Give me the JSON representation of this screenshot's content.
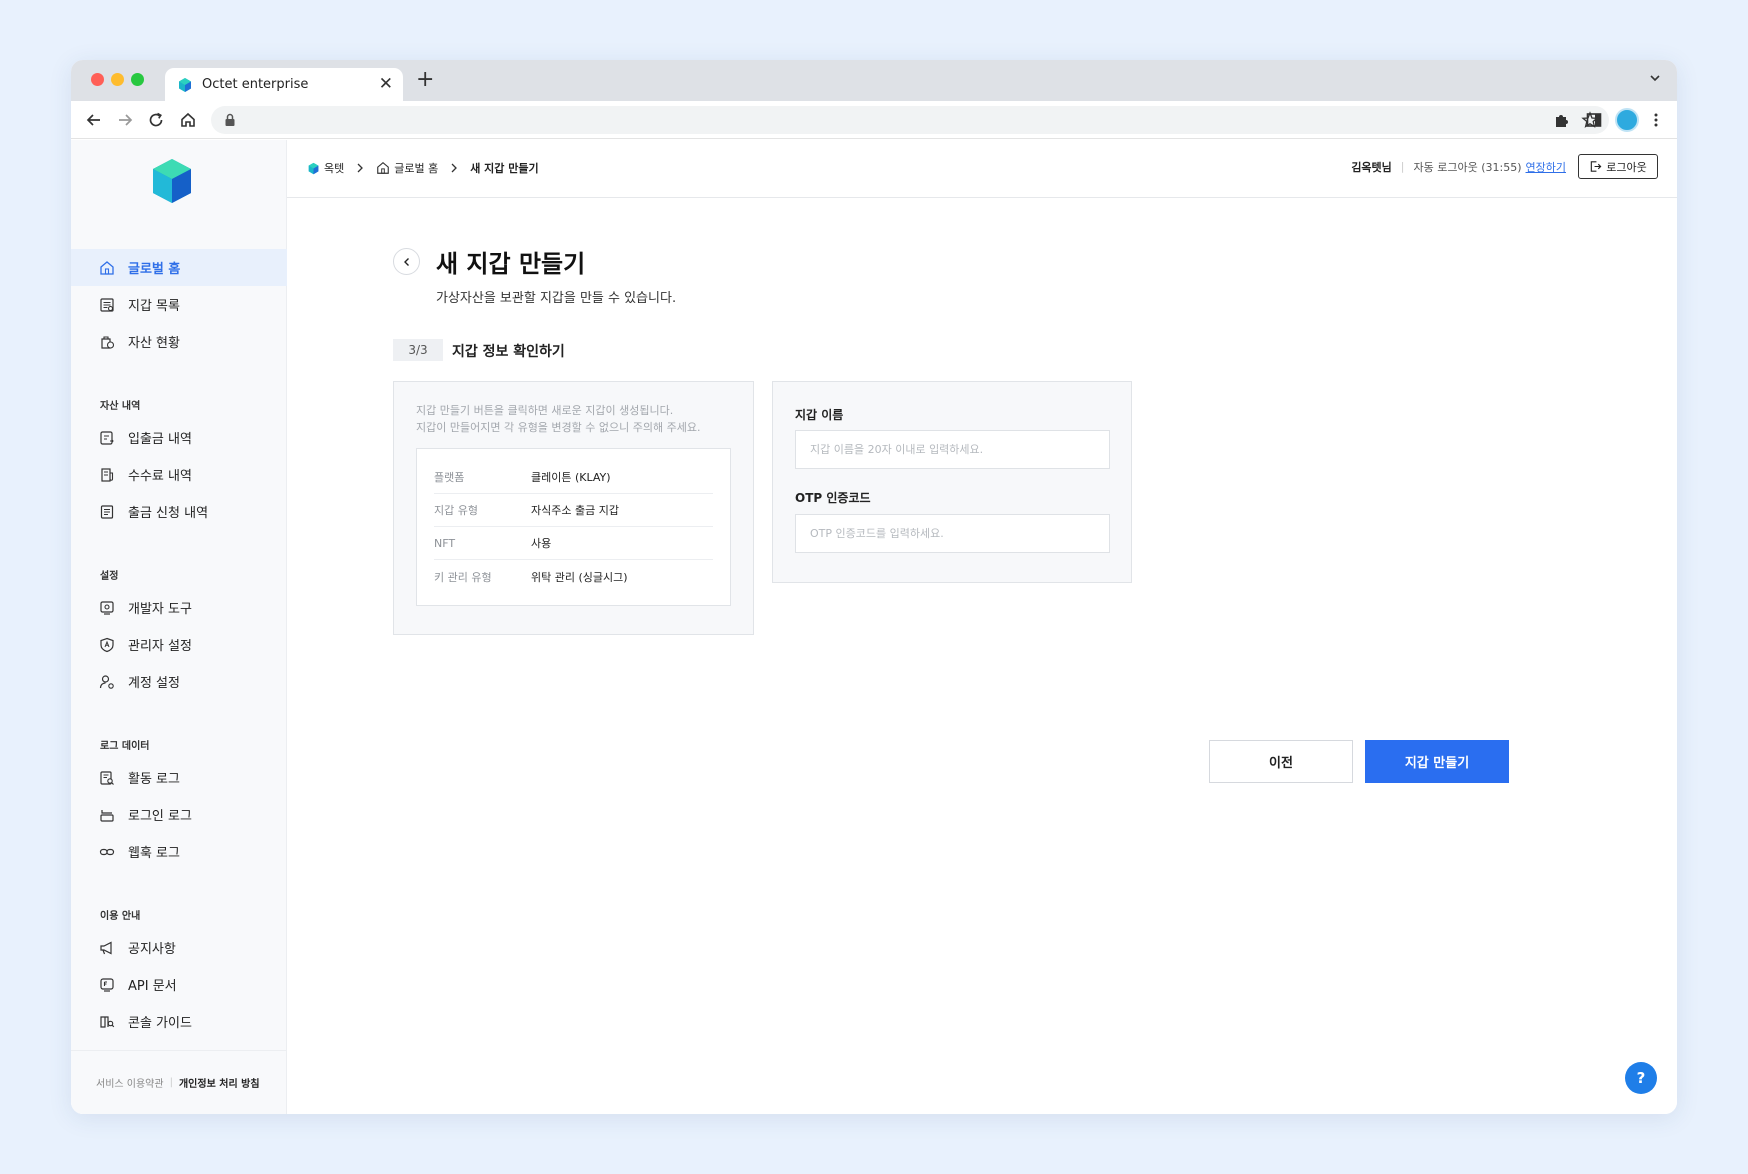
{
  "browser": {
    "tab_title": "Octet enterprise",
    "tab_close": "✕",
    "new_tab": "+"
  },
  "sidebar": {
    "top_items": [
      {
        "label": "글로벌 홈",
        "icon": "home-icon",
        "active": true
      },
      {
        "label": "지갑 목록",
        "icon": "wallet-list-icon"
      },
      {
        "label": "자산 현황",
        "icon": "asset-status-icon"
      }
    ],
    "sections": [
      {
        "title": "자산 내역",
        "items": [
          {
            "label": "입출금 내역",
            "icon": "transaction-icon"
          },
          {
            "label": "수수료 내역",
            "icon": "fee-icon"
          },
          {
            "label": "출금 신청 내역",
            "icon": "withdraw-request-icon"
          }
        ]
      },
      {
        "title": "설정",
        "items": [
          {
            "label": "개발자 도구",
            "icon": "developer-tools-icon"
          },
          {
            "label": "관리자 설정",
            "icon": "admin-shield-icon"
          },
          {
            "label": "계정 설정",
            "icon": "account-settings-icon"
          }
        ]
      },
      {
        "title": "로그 데이터",
        "items": [
          {
            "label": "활동 로그",
            "icon": "activity-log-icon"
          },
          {
            "label": "로그인 로그",
            "icon": "login-log-icon"
          },
          {
            "label": "웹훅 로그",
            "icon": "webhook-link-icon"
          }
        ]
      },
      {
        "title": "이용 안내",
        "items": [
          {
            "label": "공지사항",
            "icon": "megaphone-icon"
          },
          {
            "label": "API 문서",
            "icon": "api-doc-icon"
          },
          {
            "label": "콘솔 가이드",
            "icon": "console-guide-icon"
          }
        ]
      }
    ],
    "footer": {
      "terms": "서비스 이용약관",
      "separator": "|",
      "privacy": "개인정보 처리 방침"
    }
  },
  "header": {
    "breadcrumb": [
      "옥텟",
      "글로벌 홈",
      "새 지갑 만들기"
    ],
    "user_name": "김옥텟님",
    "separator": "|",
    "auto_logout": "자동 로그아웃 (31:55)",
    "extend_label": "연장하기",
    "logout_label": "로그아웃"
  },
  "page": {
    "title": "새 지갑 만들기",
    "subtitle": "가상자산을 보관할 지갑을 만들 수 있습니다.",
    "step": "3/3",
    "step_title": "지갑 정보 확인하기",
    "notice_lines": [
      "지갑 만들기 버튼을 클릭하면 새로운 지갑이 생성됩니다.",
      "지갑이 만들어지면 각 유형을 변경할 수 없으니 주의해 주세요."
    ],
    "info_rows": [
      {
        "key": "플랫폼",
        "value": "클레이튼 (KLAY)"
      },
      {
        "key": "지갑 유형",
        "value": "자식주소 출금 지갑"
      },
      {
        "key": "NFT",
        "value": "사용"
      },
      {
        "key": "키 관리 유형",
        "value": "위탁 관리 (싱글시그)"
      }
    ],
    "wallet_name_label": "지갑 이름",
    "wallet_name_value": "",
    "wallet_name_placeholder": "지갑 이름을 20자 이내로 입력하세요.",
    "otp_label": "OTP 인증코드",
    "otp_value": "",
    "otp_placeholder": "OTP 인증코드를 입력하세요.",
    "prev_button": "이전",
    "create_button": "지갑 만들기",
    "help_label": "?"
  },
  "colors": {
    "accent": "#2a6ef0",
    "active_nav_bg": "#e8f0fc",
    "page_bg": "#e8f1fd"
  }
}
